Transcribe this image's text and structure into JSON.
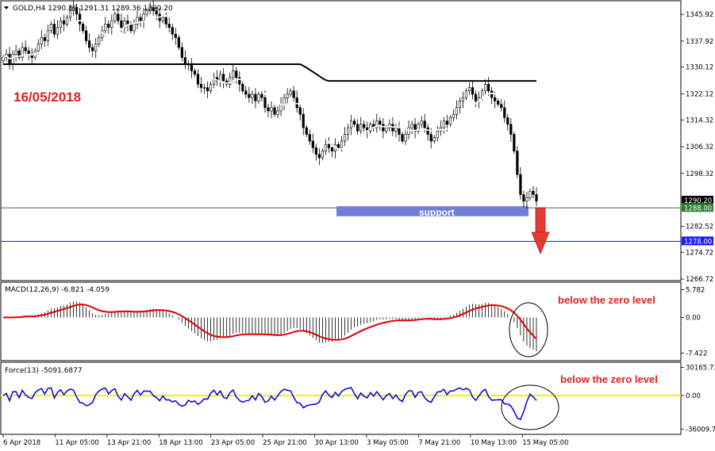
{
  "chart_data": [
    {
      "type": "candlestick",
      "title": "GOLD,H4  1290.80 1291.31 1289.36 1290.20",
      "symbol": "GOLD,H4",
      "ohlc_header": "1290.80 1291.31 1289.36 1290.20",
      "annotation_date": "16/05/2018",
      "support_label": "support",
      "price_labels": {
        "current": "1290.20",
        "support": "1288.00",
        "target": "1278.00"
      },
      "yticks": [
        1345.92,
        1337.92,
        1330.12,
        1322.12,
        1314.32,
        1306.32,
        1298.32,
        1282.52,
        1274.72,
        1266.72
      ],
      "ylim": [
        1266.72,
        1349.5
      ],
      "levels": {
        "support": 1288.0,
        "target": 1278.0
      },
      "support_zone": {
        "from": 1285.5,
        "to": 1288.5
      },
      "colors": {
        "bull": "#ffffff",
        "bear": "#000000",
        "ma_fast": "#ffffff",
        "ma_slow": "#000000",
        "support": "#6f80d8",
        "level_green": "#2e7d32",
        "level_blue": "#1a1aff",
        "arrow": "#e53935",
        "note": "#e02020"
      },
      "closes": [
        1333,
        1334,
        1331,
        1334,
        1335,
        1333,
        1336,
        1335,
        1334,
        1333,
        1335,
        1337,
        1339,
        1338,
        1341,
        1343,
        1340,
        1342,
        1344,
        1343,
        1345,
        1347,
        1348,
        1346,
        1343,
        1341,
        1338,
        1336,
        1335,
        1337,
        1339,
        1341,
        1343,
        1342,
        1344,
        1346,
        1344,
        1342,
        1344,
        1343,
        1341,
        1343,
        1345,
        1344,
        1346,
        1347,
        1348,
        1347,
        1346,
        1344,
        1345,
        1343,
        1342,
        1340,
        1339,
        1336,
        1333,
        1331,
        1331,
        1329,
        1328,
        1325,
        1324,
        1324,
        1323,
        1325,
        1327,
        1326,
        1328,
        1326,
        1325,
        1327,
        1329,
        1327,
        1325,
        1323,
        1322,
        1321,
        1322,
        1320,
        1322,
        1321,
        1318,
        1317,
        1318,
        1316,
        1317,
        1319,
        1321,
        1322,
        1323,
        1321,
        1318,
        1316,
        1312,
        1310,
        1308,
        1306,
        1304,
        1303,
        1305,
        1307,
        1306,
        1305,
        1307,
        1306,
        1308,
        1310,
        1312,
        1314,
        1313,
        1311,
        1313,
        1312,
        1311,
        1313,
        1312,
        1314,
        1313,
        1311,
        1312,
        1313,
        1311,
        1312,
        1310,
        1308,
        1310,
        1312,
        1313,
        1311,
        1313,
        1314,
        1312,
        1310,
        1308,
        1309,
        1311,
        1312,
        1314,
        1313,
        1315,
        1316,
        1318,
        1320,
        1321,
        1323,
        1324,
        1322,
        1320,
        1321,
        1323,
        1325,
        1323,
        1321,
        1320,
        1319,
        1318,
        1315,
        1313,
        1310,
        1305,
        1298,
        1292,
        1290,
        1291,
        1293,
        1292,
        1290
      ],
      "ma_fast_label": "",
      "ma_slow_label": ""
    },
    {
      "type": "bar+line",
      "title": "MACD(12,26,9) -6.821 -4.059",
      "indicator": "MACD(12,26,9)",
      "values_label": "-6.821 -4.059",
      "note": "below the zero level",
      "yticks": [
        5.782,
        0.0,
        -7.422
      ],
      "ylim": [
        -8.5,
        7.0
      ]
    },
    {
      "type": "line",
      "title": "Force(13) -5091.6877",
      "indicator": "Force(13)",
      "values_label": "-5091.6877",
      "note": "below the zero level",
      "yticks": [
        30165.73,
        0.0,
        -36009.76
      ],
      "ylim": [
        -40000,
        34000
      ]
    }
  ],
  "xticks": [
    "6 Apr 2018",
    "11 Apr 05:00",
    "13 Apr 21:00",
    "18 Apr 13:00",
    "23 Apr 05:00",
    "25 Apr 21:00",
    "30 Apr 13:00",
    "3 May 05:00",
    "7 May 21:00",
    "10 May 13:00",
    "15 May 05:00"
  ]
}
